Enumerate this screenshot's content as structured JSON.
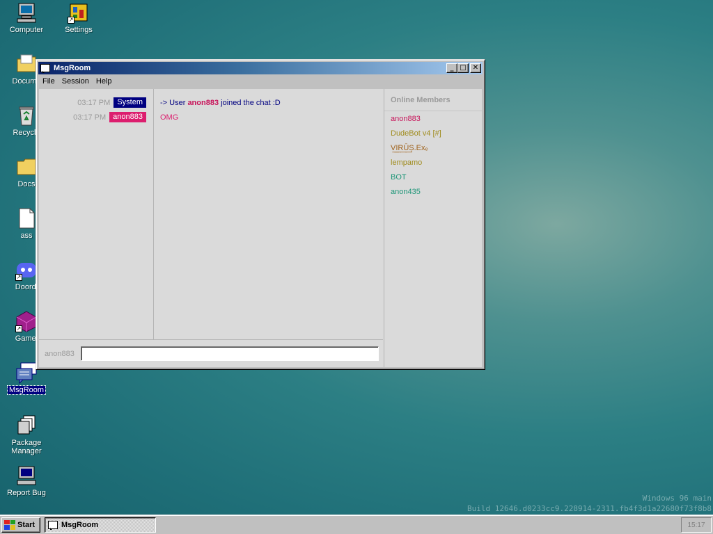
{
  "desktop": {
    "icons": [
      {
        "label": "Computer",
        "icon": "computer-icon"
      },
      {
        "label": "Settings",
        "icon": "settings-icon"
      },
      {
        "label": "Docume",
        "icon": "documents-folder-icon"
      },
      {
        "label": "Recycle",
        "icon": "recycle-bin-icon"
      },
      {
        "label": "Docs",
        "icon": "folder-icon"
      },
      {
        "label": "ass",
        "icon": "file-icon"
      },
      {
        "label": "Doordi",
        "icon": "discord-icon"
      },
      {
        "label": "Gamei",
        "icon": "game-icon"
      },
      {
        "label": "MsgRoom",
        "icon": "msgroom-icon"
      },
      {
        "label": "Package\nManager",
        "icon": "package-manager-icon"
      },
      {
        "label": "Report Bug",
        "icon": "report-bug-icon"
      }
    ],
    "watermark_line1": "Windows 96 main",
    "watermark_line2": "Build 12646.d0233cc9.228914-2311.fb4f3d1a22680f73f8b8"
  },
  "window": {
    "title": "MsgRoom",
    "menu": [
      "File",
      "Session",
      "Help"
    ],
    "controls": {
      "minimize": "_",
      "maximize": "□",
      "close": "✕"
    }
  },
  "chat": {
    "messages": [
      {
        "time": "03:17 PM",
        "sender": "System",
        "sender_color": "#000080",
        "prefix": "-> User ",
        "highlight": "anon883",
        "highlight_color": "#c8145a",
        "suffix": " joined the chat :D",
        "text_color": "#000080"
      },
      {
        "time": "03:17 PM",
        "sender": "anon883",
        "sender_color": "#dc1e6e",
        "text": "OMG",
        "text_color": "#dc1e6e"
      }
    ]
  },
  "members": {
    "heading": "Online Members",
    "list": [
      {
        "name": "anon883",
        "color": "#c8145a"
      },
      {
        "name": "DudeBot v4 [#]",
        "color": "#a08c1e"
      },
      {
        "name": "V͟I͟R͟Ū͟Ș.Exₑ",
        "color": "#a0641e"
      },
      {
        "name": "lempamo",
        "color": "#a08c1e"
      },
      {
        "name": "BOT",
        "color": "#1e9678"
      },
      {
        "name": "anon435",
        "color": "#1e9678"
      }
    ]
  },
  "input": {
    "nick": "anon883",
    "value": "",
    "placeholder": ""
  },
  "taskbar": {
    "start_label": "Start",
    "task_label": "MsgRoom",
    "clock": "15:17"
  }
}
